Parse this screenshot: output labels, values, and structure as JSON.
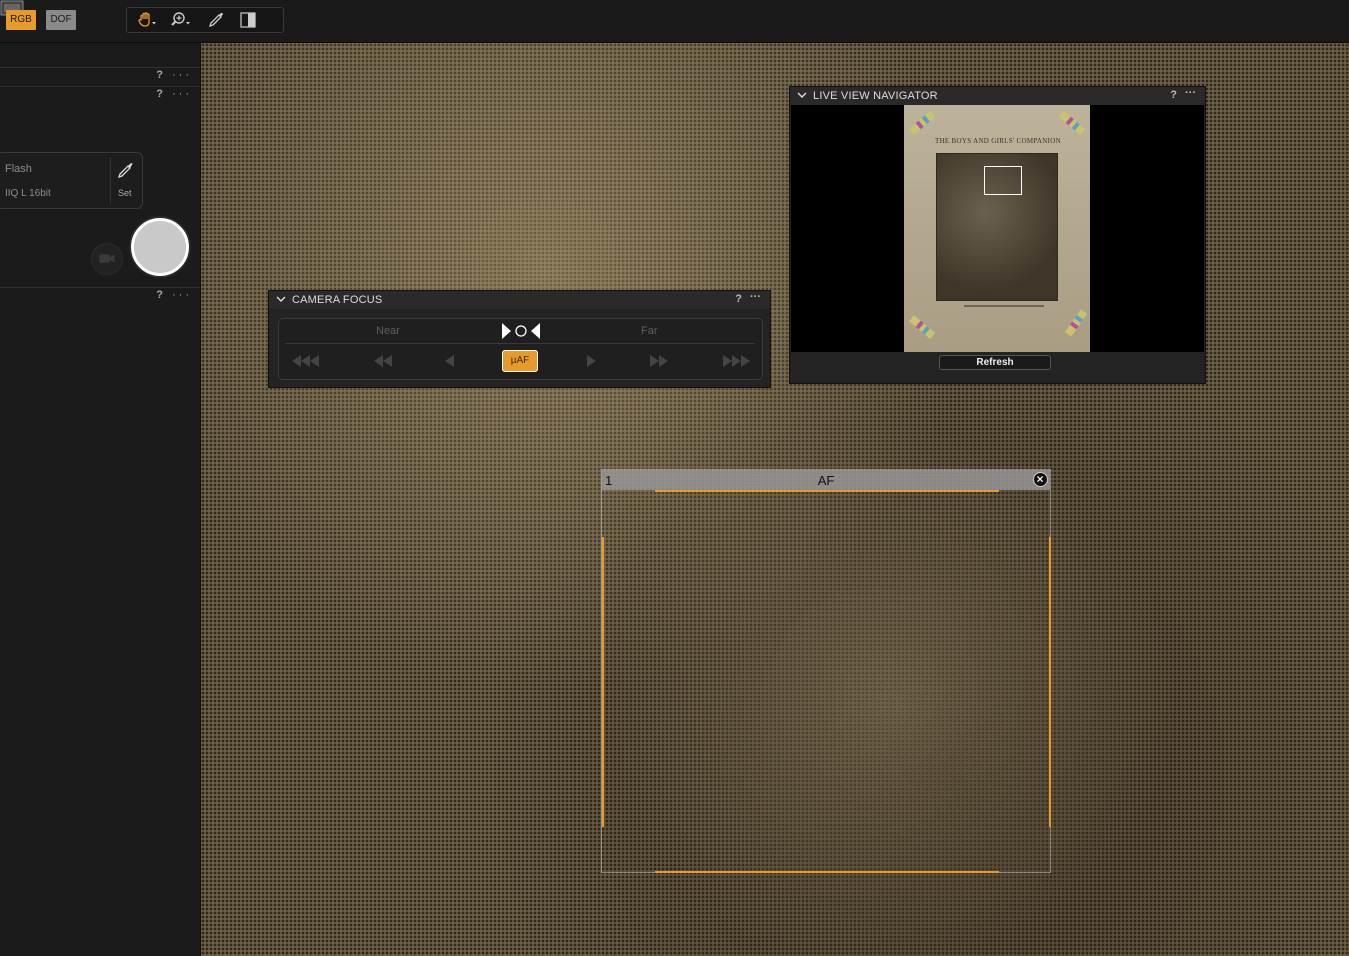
{
  "toolbar": {
    "rgb_label": "RGB",
    "dof_label": "DOF",
    "accent_color": "#e99b2a",
    "tools": [
      "hand-icon",
      "zoom-icon",
      "picker-icon",
      "compare-icon"
    ]
  },
  "sidebar": {
    "panel_help": "?",
    "panel_more": "···",
    "flash": {
      "label": "Flash",
      "format": "IIQ L 16bit",
      "set_label": "Set"
    }
  },
  "camera_focus": {
    "title": "CAMERA FOCUS",
    "help": "?",
    "more": "···",
    "near_label": "Near",
    "far_label": "Far",
    "af_label": "µAF"
  },
  "navigator": {
    "title": "LIVE VIEW NAVIGATOR",
    "help": "?",
    "more": "···",
    "doc_title": "THE BOYS AND GIRLS' COMPANION",
    "refresh_label": "Refresh"
  },
  "af_overlay": {
    "index": "1",
    "label": "AF"
  }
}
